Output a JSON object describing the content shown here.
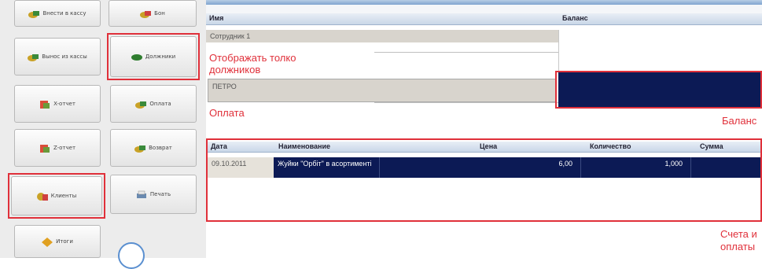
{
  "left_buttons": [
    {
      "label": "Внести в кассу",
      "col": 0,
      "row": 0,
      "icon": "cash-icon"
    },
    {
      "label": "Вынос из кассы",
      "col": 0,
      "row": 1,
      "icon": "cash-icon"
    },
    {
      "label": "X-отчет",
      "col": 0,
      "row": 2,
      "icon": "report-icon"
    },
    {
      "label": "Z-отчет",
      "col": 0,
      "row": 3,
      "icon": "report-icon"
    },
    {
      "label": "Клиенты",
      "col": 0,
      "row": 4,
      "icon": "clients-icon"
    },
    {
      "label": "Итоги",
      "col": 0,
      "row": 5,
      "icon": "totals-icon"
    },
    {
      "label": "Бон",
      "col": 1,
      "row": 0,
      "icon": "cash-icon"
    },
    {
      "label": "Должники",
      "col": 1,
      "row": 1,
      "icon": "debtors-icon"
    },
    {
      "label": "Оплата",
      "col": 1,
      "row": 2,
      "icon": "cash-icon"
    },
    {
      "label": "Возврат",
      "col": 1,
      "row": 3,
      "icon": "cash-icon"
    },
    {
      "label": "Печать",
      "col": 1,
      "row": 4,
      "icon": "print-icon"
    }
  ],
  "clients_table": {
    "headers": [
      "Имя",
      "Баланс"
    ],
    "rows": [
      {
        "name": "Сотрудник 1",
        "balance": ""
      },
      {
        "name": "",
        "balance": ""
      }
    ]
  },
  "payment_section": {
    "name_value": "ПЕТРО",
    "balance_value": ""
  },
  "invoices_table": {
    "headers": [
      "Дата",
      "Наименование",
      "Цена",
      "Количество",
      "Сумма"
    ],
    "rows": [
      {
        "date": "09.10.2011",
        "name": "Жуйки \"Орбіт\" в асортименті",
        "price": "6,00",
        "qty": "1,000",
        "sum": ""
      }
    ]
  },
  "annotations": {
    "debtors_only": "Отображать только должников",
    "debtors_only_line1": "Отображать толко",
    "debtors_only_line2": "должников",
    "payment": "Оплата",
    "balance": "Баланс",
    "invoices_line1": "Счета и",
    "invoices_line2": "оплаты"
  },
  "colors": {
    "annotation_red": "#e0303a",
    "selection_navy": "#0c1a55"
  }
}
